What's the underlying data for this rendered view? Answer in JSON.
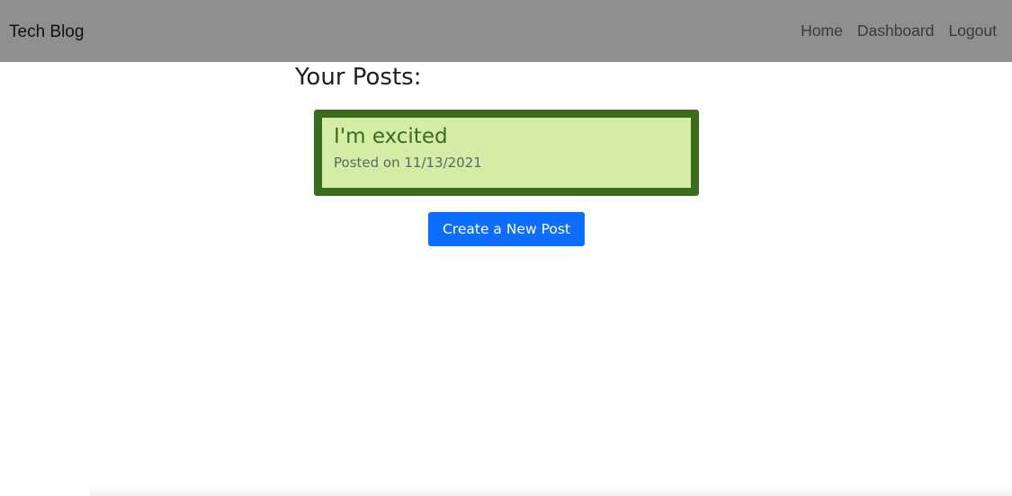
{
  "navbar": {
    "brand": "Tech Blog",
    "links": [
      {
        "label": "Home"
      },
      {
        "label": "Dashboard"
      },
      {
        "label": "Logout"
      }
    ],
    "background_color": "#8f8f8f"
  },
  "main": {
    "heading": "Your Posts:",
    "posts": [
      {
        "title": "I'm excited",
        "date_text": "Posted on 11/13/2021"
      }
    ],
    "create_button_label": "Create a New Post"
  },
  "colors": {
    "card_background": "#d3eda7",
    "card_border": "#3a6b1f",
    "button_primary": "#0d6efd"
  }
}
